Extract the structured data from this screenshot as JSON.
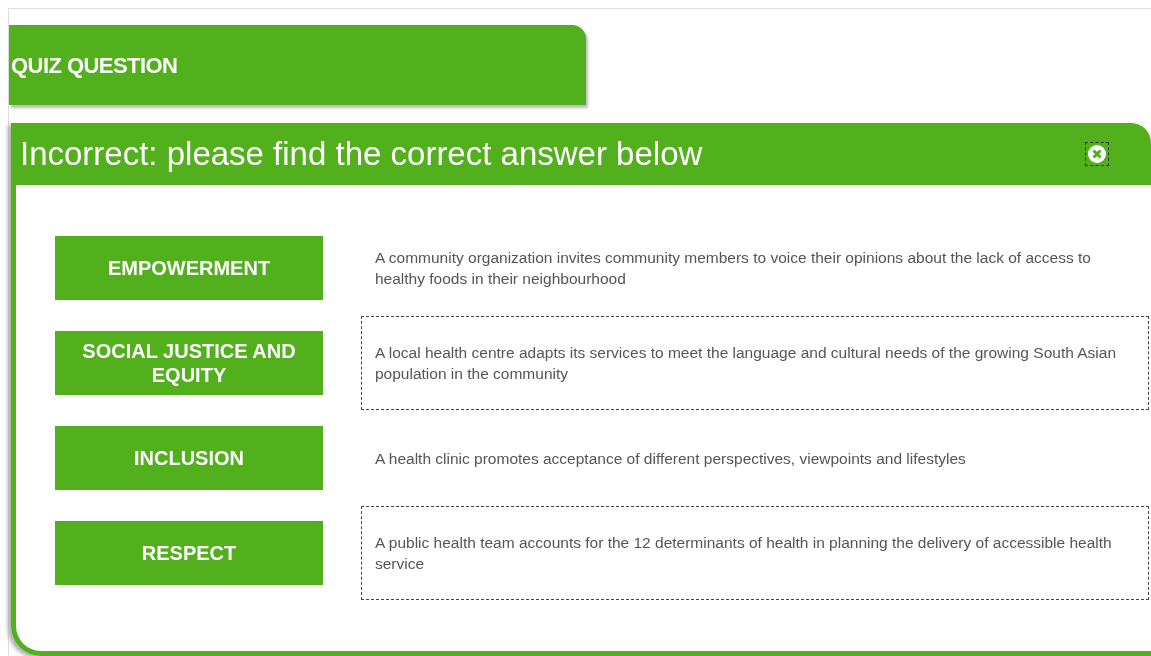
{
  "header": {
    "title": "QUIZ QUESTION"
  },
  "feedback": {
    "title": "Incorrect: please find the correct answer below"
  },
  "pairs": [
    {
      "term": "EMPOWERMENT",
      "description": "A community organization invites community members to voice their opinions about the lack of access to healthy foods in their neighbourhood",
      "outlined": false
    },
    {
      "term": "SOCIAL JUSTICE AND EQUITY",
      "description": "A local health centre adapts its services to meet the language and cultural needs of the growing South Asian population in the community",
      "outlined": true
    },
    {
      "term": "INCLUSION",
      "description": "A health clinic promotes acceptance of different perspectives, viewpoints and lifestyles",
      "outlined": false
    },
    {
      "term": "RESPECT",
      "description": "A public health team accounts for the 12 determinants of health in planning the delivery of accessible health service",
      "outlined": true
    }
  ]
}
